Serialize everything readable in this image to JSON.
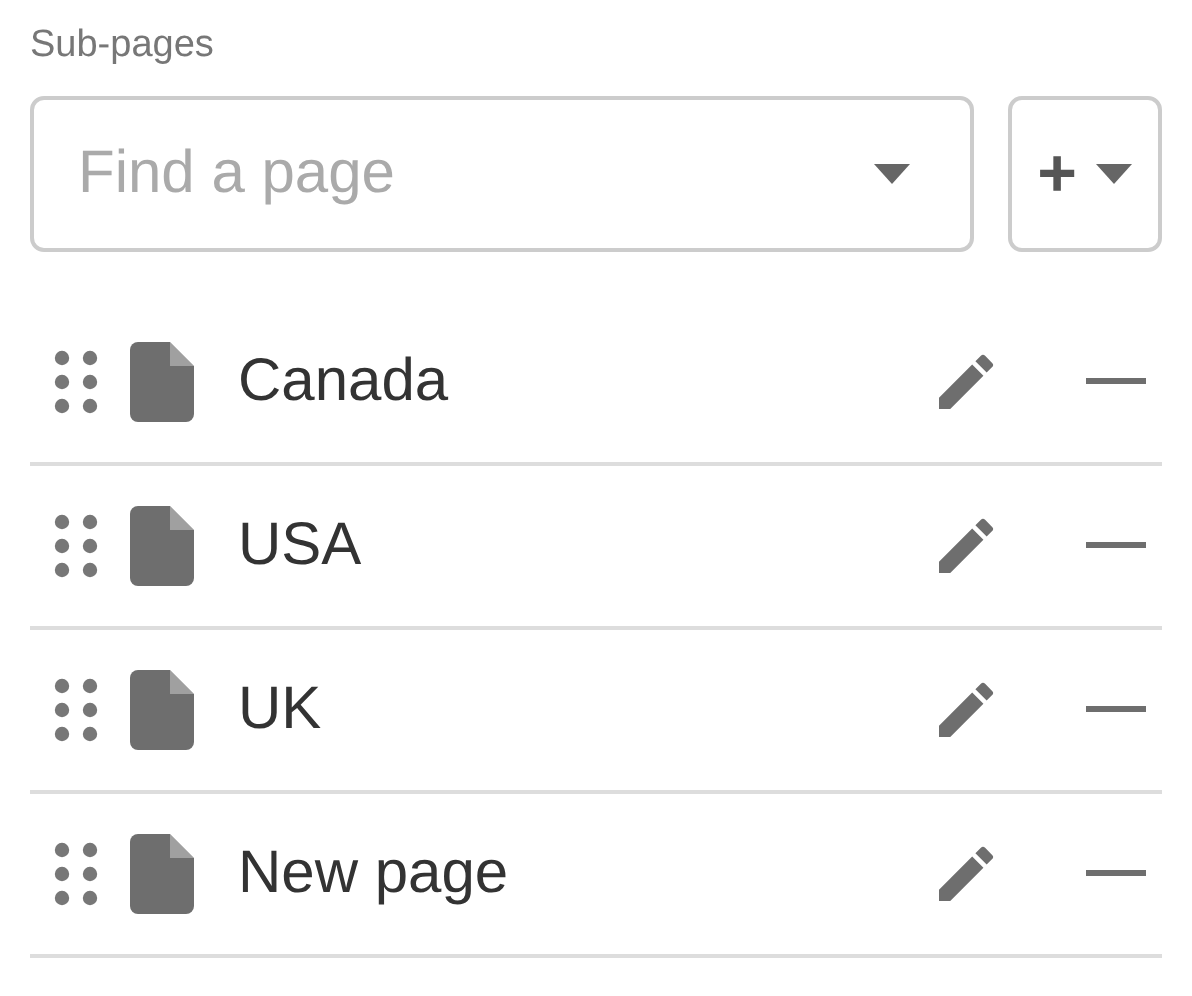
{
  "section_label": "Sub-pages",
  "search": {
    "placeholder": "Find a page"
  },
  "add_button": {
    "label": "+"
  },
  "pages": [
    {
      "title": "Canada"
    },
    {
      "title": "USA"
    },
    {
      "title": "UK"
    },
    {
      "title": "New page"
    }
  ]
}
